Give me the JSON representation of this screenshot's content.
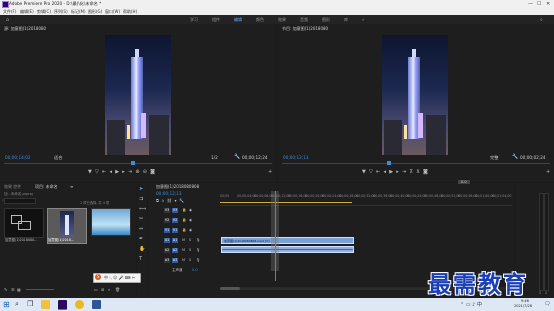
{
  "window": {
    "title": "Adobe Premiere Pro 2020 - D:\\最(\\化\\未命名 *",
    "min": "—",
    "max": "☐",
    "close": "✕"
  },
  "menu": [
    "文件(F)",
    "编辑(E)",
    "剪辑(C)",
    "序列(S)",
    "标记(M)",
    "图形(G)",
    "窗口(W)",
    "帮助(H)"
  ],
  "workspaces": {
    "items": [
      "学习",
      "组件",
      "编辑",
      "颜色",
      "效果",
      "音频",
      "图形",
      "库"
    ],
    "active_index": 2,
    "more": "»"
  },
  "source_monitor": {
    "tab": "源: 加意图(1)2018080",
    "timecode": "00;00;14;02",
    "fit": "适合",
    "fraction": "1/2",
    "duration": "00;00;12;24"
  },
  "program_monitor": {
    "tab": "节目: 加意图(1)2018080",
    "timecode": "00;00;12;13",
    "fit": "适合",
    "fraction": "完整",
    "duration": "00;00;02;24"
  },
  "project_panel": {
    "tab_effects": "效果 控件",
    "tab_project": "项目: 未命名",
    "menu": "≡",
    "path": "加...未命名.prproj",
    "search_placeholder": "",
    "selection_info": "1 项已选择, 共 4 项",
    "items": [
      {
        "name": "加意图(1)2018080..."
      },
      {
        "name": "加意图(1)2018..."
      },
      {
        "name": ""
      }
    ]
  },
  "timeline": {
    "tab": "加意图(1)2018080808",
    "timecode": "00;00;12;13",
    "ruler": [
      "00;00",
      "00;00;04;00",
      "00;00;08;00",
      "00;00;12;00",
      "00;00;16;00",
      "00;00;20;00",
      "00;00;24;00",
      "00;00;28;00",
      "00;00;32;00",
      "00;00;36;00",
      "00;00;40;00",
      "00;00;44;00",
      "00;00;48;00",
      "00;00;52;00",
      "00;00;56;00",
      "00;01;00;00",
      "00;01;04;00"
    ],
    "tracks": [
      "V3",
      "V2",
      "V1",
      "A1",
      "A2",
      "A3"
    ],
    "master_label": "主声道",
    "master_value": "0.0",
    "clip_label": "加意图(1)2018080808.mp4 [V]",
    "badge": "0.0"
  },
  "watermark": "最需教育",
  "taskbar": {
    "time": "9:46",
    "date": "2021/7/28"
  },
  "colors": {
    "accent": "#3a8dde",
    "playhead": "#3a8dde",
    "clip": "#7aa0d8",
    "watermark": "#1a3fb5"
  }
}
